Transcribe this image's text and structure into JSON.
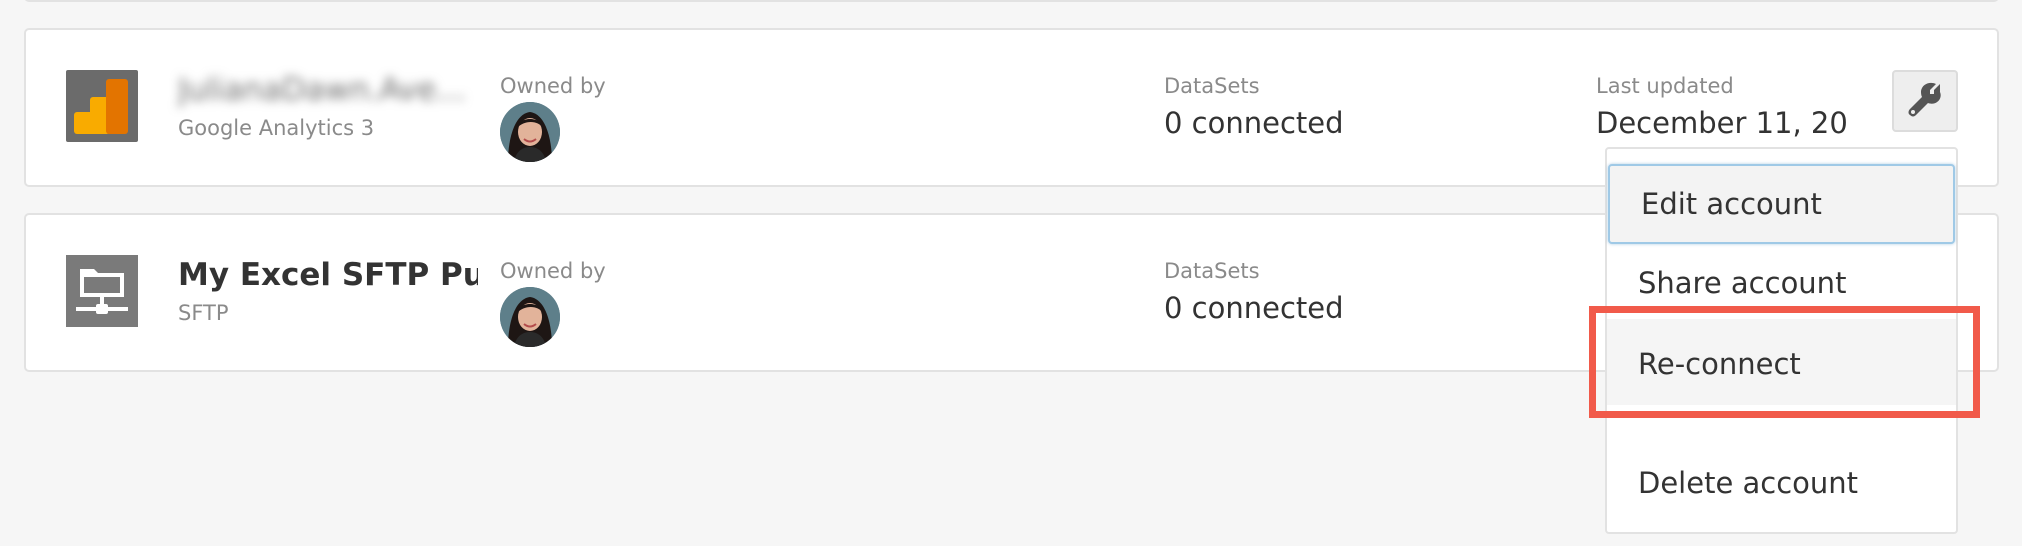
{
  "accounts": [
    {
      "name": "JulianaDawn.Ave...",
      "type": "Google Analytics 3",
      "owned_by_label": "Owned by",
      "datasets_label": "DataSets",
      "datasets_value": "0 connected",
      "last_updated_label": "Last updated",
      "last_updated_value": "December 11, 20...",
      "icon": "google-analytics-icon"
    },
    {
      "name": "My Excel SFTP Pu...",
      "type": "SFTP",
      "owned_by_label": "Owned by",
      "datasets_label": "DataSets",
      "datasets_value": "0 connected",
      "icon": "sftp-folder-network-icon"
    }
  ],
  "menu": {
    "items": [
      "Edit account",
      "Share account",
      "Re-connect",
      "Delete account"
    ]
  },
  "colors": {
    "highlight": "#f15a4a",
    "icon_bg": "#6b6b6b",
    "ga_yellow": "#f9ab00",
    "ga_orange": "#e37400",
    "focus_border": "#9fc9e6"
  },
  "icons": {
    "wrench": "wrench-icon",
    "avatar": "user-avatar"
  }
}
